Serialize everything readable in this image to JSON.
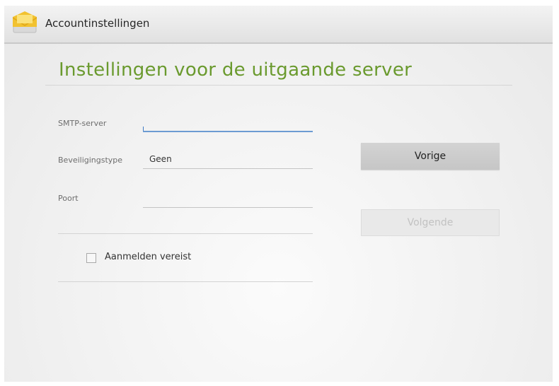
{
  "app": {
    "title": "Accountinstellingen",
    "icon": "email-app-icon"
  },
  "page": {
    "heading": "Instellingen voor de uitgaande server"
  },
  "form": {
    "smtp_server": {
      "label": "SMTP-server",
      "value": ""
    },
    "security_type": {
      "label": "Beveiligingstype",
      "value": "Geen"
    },
    "port": {
      "label": "Poort",
      "value": ""
    },
    "login_required": {
      "label": "Aanmelden vereist",
      "checked": false
    }
  },
  "buttons": {
    "previous": "Vorige",
    "next": "Volgende"
  },
  "colors": {
    "heading": "#6a9a2e",
    "focus_underline": "#6c9bd2"
  }
}
